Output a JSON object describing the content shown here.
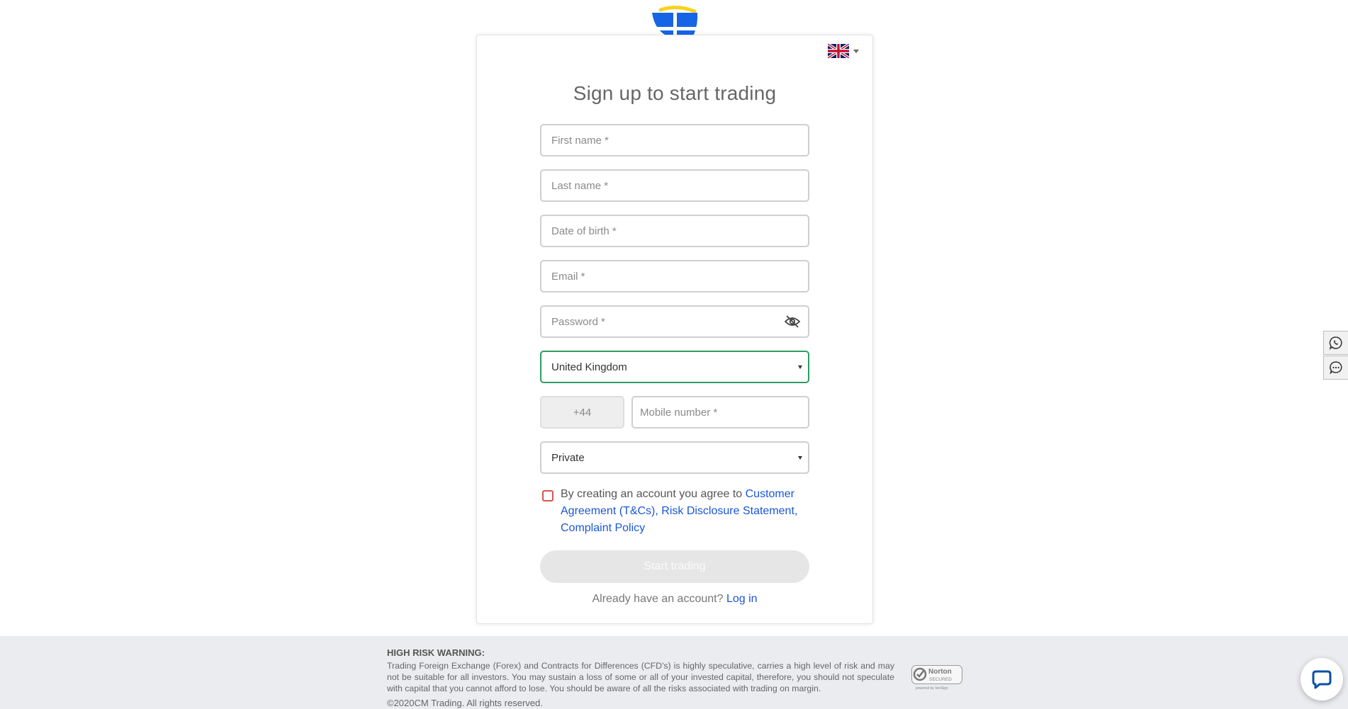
{
  "header": {
    "language": "English",
    "title": "Sign up to start trading"
  },
  "form": {
    "first_name_placeholder": "First name *",
    "last_name_placeholder": "Last name *",
    "dob_placeholder": "Date of birth *",
    "email_placeholder": "Email *",
    "password_placeholder": "Password *",
    "country_value": "United Kingdom",
    "phone_prefix": "+44",
    "mobile_placeholder": "Mobile number *",
    "account_type_value": "Private"
  },
  "terms": {
    "intro": "By creating an account you agree to ",
    "link_agreement": "Customer Agreement (T&Cs),",
    "link_risk": "Risk Disclosure Statement,",
    "link_complaint": "Complaint Policy",
    "checked": false
  },
  "actions": {
    "submit_label": "Start trading",
    "login_prompt": "Already have an account?",
    "login_link": "Log in"
  },
  "footer": {
    "warning_title": "HIGH RISK WARNING:",
    "warning_text": "Trading Foreign Exchange (Forex) and Contracts for Differences (CFD's) is highly speculative, carries a high level of risk and may not be suitable for all investors. You may sustain a loss of some or all of your invested capital, therefore, you should not speculate with capital that you cannot afford to lose. You should be aware of all the risks associated with trading on margin.",
    "copyright": "©2020CM Trading. All rights reserved.",
    "norton_brand": "Norton",
    "norton_secured": "SECURED",
    "norton_powered": "powered by VeriSign"
  },
  "colors": {
    "brand_blue": "#1565e6",
    "brand_yellow": "#f7d21e",
    "link_blue": "#1a56d6",
    "active_border": "#2e9d63",
    "error_red": "#d9534f"
  },
  "icons": {
    "logo": "cm-trading-logo",
    "flag": "uk-flag-icon",
    "eye": "eye-icon",
    "whatsapp": "whatsapp-icon",
    "chat": "chat-icon",
    "livechat": "livechat-bubble-icon"
  }
}
